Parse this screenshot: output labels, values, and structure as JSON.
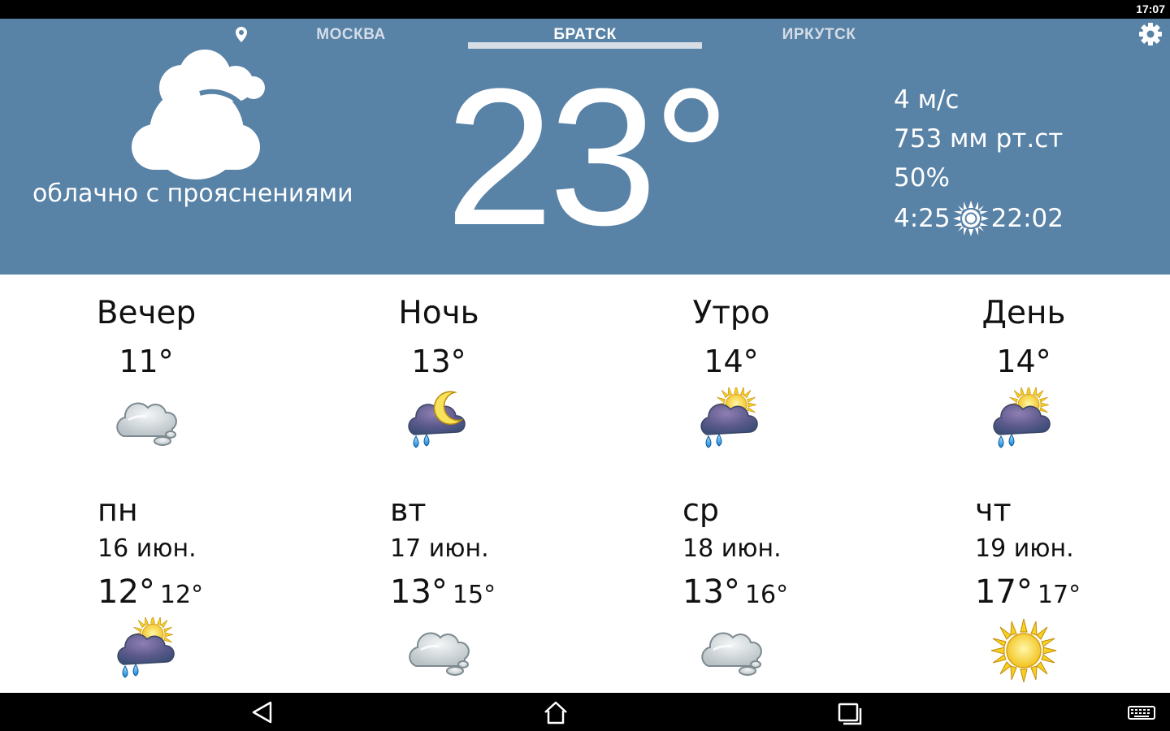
{
  "status_bar": {
    "time": "17:07"
  },
  "tabs": [
    {
      "label": "МОСКВА",
      "active": false
    },
    {
      "label": "БРАТСК",
      "active": true
    },
    {
      "label": "ИРКУТСК",
      "active": false
    }
  ],
  "current": {
    "icon": "cloud-sun-icon",
    "description": "облачно с прояснениями",
    "temperature": "23°",
    "wind": "4 м/с",
    "pressure": "753 мм рт.ст",
    "humidity": "50%",
    "sunrise": "4:25",
    "sunset": "22:02"
  },
  "day_parts": [
    {
      "name": "Вечер",
      "temp": "11°",
      "icon": "cloudy-icon"
    },
    {
      "name": "Ночь",
      "temp": "13°",
      "icon": "night-rain-icon"
    },
    {
      "name": "Утро",
      "temp": "14°",
      "icon": "sun-rain-icon"
    },
    {
      "name": "День",
      "temp": "14°",
      "icon": "sun-rain-icon"
    }
  ],
  "forecast": [
    {
      "day": "пн",
      "date": "16 июн.",
      "max": "12°",
      "min": "12°",
      "icon": "sun-rain-icon"
    },
    {
      "day": "вт",
      "date": "17 июн.",
      "max": "13°",
      "min": "15°",
      "icon": "cloudy-icon"
    },
    {
      "day": "ср",
      "date": "18 июн.",
      "max": "13°",
      "min": "16°",
      "icon": "cloudy-icon"
    },
    {
      "day": "чт",
      "date": "19 июн.",
      "max": "17°",
      "min": "17°",
      "icon": "sun-icon"
    }
  ],
  "colors": {
    "header_bg": "#5882a6",
    "status_bg": "#000000",
    "tab_indicator": "#d6dde5"
  }
}
